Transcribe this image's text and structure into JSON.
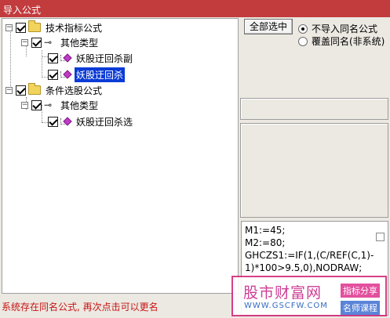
{
  "window": {
    "title": "导入公式"
  },
  "tree": {
    "tech_group": "技术指标公式",
    "tech_other": "其他类型",
    "tech_item1": "妖股迂回杀副",
    "tech_item2": "妖股迂回杀",
    "cond_group": "条件选股公式",
    "cond_other": "其他类型",
    "cond_item1": "妖股迂回杀选"
  },
  "controls": {
    "select_all": "全部选中",
    "radio_no_import": "不导入同名公式",
    "radio_overwrite": "覆盖同名(非系统)"
  },
  "code": {
    "line1": "M1:=45;",
    "line2": "M2:=80;",
    "line3": "GHCZS1:=IF(1,(C/REF(C,1)-",
    "line4": "1)*100>9.5,0),NODRAW;"
  },
  "watermark": {
    "title": "股市财富网",
    "tag1": "指标分享",
    "url": "WWW.GSCFW.COM",
    "tag2": "名师课程"
  },
  "status": {
    "message": "系统存在同名公式, 再次点击可以更名"
  }
}
